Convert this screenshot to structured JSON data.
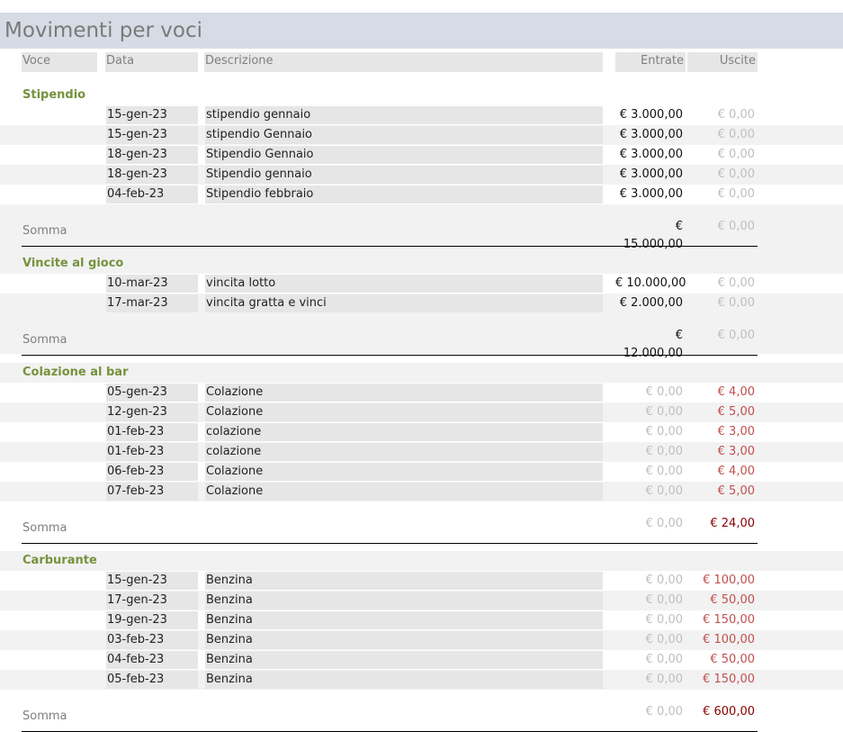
{
  "report": {
    "title": "Movimenti per voci",
    "columns": {
      "voce": "Voce",
      "data": "Data",
      "descrizione": "Descrizione",
      "entrate": "Entrate",
      "uscite": "Uscite"
    },
    "groups": [
      {
        "name": "Stipendio",
        "rows": [
          {
            "data": "15-gen-23",
            "descrizione": "stipendio gennaio",
            "entrate": "€ 3.000,00",
            "uscite": "€ 0,00"
          },
          {
            "data": "15-gen-23",
            "descrizione": "stipendio Gennaio",
            "entrate": "€ 3.000,00",
            "uscite": "€ 0,00"
          },
          {
            "data": "18-gen-23",
            "descrizione": "Stipendio Gennaio",
            "entrate": "€ 3.000,00",
            "uscite": "€ 0,00"
          },
          {
            "data": "18-gen-23",
            "descrizione": "Stipendio gennaio",
            "entrate": "€ 3.000,00",
            "uscite": "€ 0,00"
          },
          {
            "data": "04-feb-23",
            "descrizione": "Stipendio febbraio",
            "entrate": "€ 3.000,00",
            "uscite": "€ 0,00"
          }
        ],
        "somma_label": "Somma",
        "somma_entrate": "€ 15.000,00",
        "somma_uscite": "€ 0,00"
      },
      {
        "name": "Vincite al gioco",
        "rows": [
          {
            "data": "10-mar-23",
            "descrizione": "vincita lotto",
            "entrate": "€ 10.000,00",
            "uscite": "€ 0,00"
          },
          {
            "data": "17-mar-23",
            "descrizione": "vincita gratta e vinci",
            "entrate": "€ 2.000,00",
            "uscite": "€ 0,00"
          }
        ],
        "somma_label": "Somma",
        "somma_entrate": "€ 12.000,00",
        "somma_uscite": "€ 0,00"
      },
      {
        "name": "Colazione al bar",
        "rows": [
          {
            "data": "05-gen-23",
            "descrizione": "Colazione",
            "entrate": "€ 0,00",
            "uscite": "€ 4,00"
          },
          {
            "data": "12-gen-23",
            "descrizione": "Colazione",
            "entrate": "€ 0,00",
            "uscite": "€ 5,00"
          },
          {
            "data": "01-feb-23",
            "descrizione": "colazione",
            "entrate": "€ 0,00",
            "uscite": "€ 3,00"
          },
          {
            "data": "01-feb-23",
            "descrizione": "colazione",
            "entrate": "€ 0,00",
            "uscite": "€ 3,00"
          },
          {
            "data": "06-feb-23",
            "descrizione": "Colazione",
            "entrate": "€ 0,00",
            "uscite": "€ 4,00"
          },
          {
            "data": "07-feb-23",
            "descrizione": "Colazione",
            "entrate": "€ 0,00",
            "uscite": "€ 5,00"
          }
        ],
        "somma_label": "Somma",
        "somma_entrate": "€ 0,00",
        "somma_uscite": "€ 24,00"
      },
      {
        "name": "Carburante",
        "rows": [
          {
            "data": "15-gen-23",
            "descrizione": "Benzina",
            "entrate": "€ 0,00",
            "uscite": "€ 100,00"
          },
          {
            "data": "17-gen-23",
            "descrizione": "Benzina",
            "entrate": "€ 0,00",
            "uscite": "€ 50,00"
          },
          {
            "data": "19-gen-23",
            "descrizione": "Benzina",
            "entrate": "€ 0,00",
            "uscite": "€ 150,00"
          },
          {
            "data": "03-feb-23",
            "descrizione": "Benzina",
            "entrate": "€ 0,00",
            "uscite": "€ 100,00"
          },
          {
            "data": "04-feb-23",
            "descrizione": "Benzina",
            "entrate": "€ 0,00",
            "uscite": "€ 50,00"
          },
          {
            "data": "05-feb-23",
            "descrizione": "Benzina",
            "entrate": "€ 0,00",
            "uscite": "€ 150,00"
          }
        ],
        "somma_label": "Somma",
        "somma_entrate": "€ 0,00",
        "somma_uscite": "€ 600,00"
      }
    ]
  },
  "colors": {
    "title_band": "#d6dce5",
    "group_label": "#76923c",
    "zero_amount": "#bfbfbf",
    "expense": "#c0504d",
    "expense_total": "#8b0000",
    "alt_band": "#f2f2f2",
    "field_bg": "#e6e6e6"
  }
}
